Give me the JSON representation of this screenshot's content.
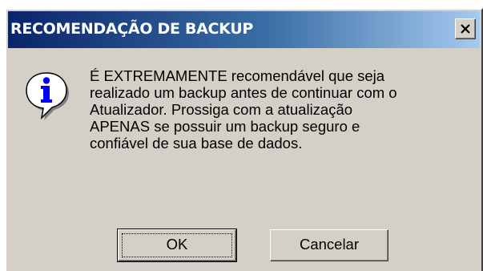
{
  "dialog": {
    "title": "RECOMENDAÇÃO DE BACKUP",
    "close_label": "X",
    "icon": "info-icon",
    "message": "É EXTREMAMENTE recomendável que seja\nrealizado um backup antes de continuar com o\nAtualizador. Prossiga com a atualização\nAPENAS se possuir um backup seguro e\nconfiável de sua base de dados.",
    "buttons": {
      "ok_label": "OK",
      "cancel_label": "Cancelar"
    }
  },
  "colors": {
    "titlebar_start": "#0a246a",
    "titlebar_end": "#a6caf0",
    "window_face": "#d4d0c8"
  }
}
